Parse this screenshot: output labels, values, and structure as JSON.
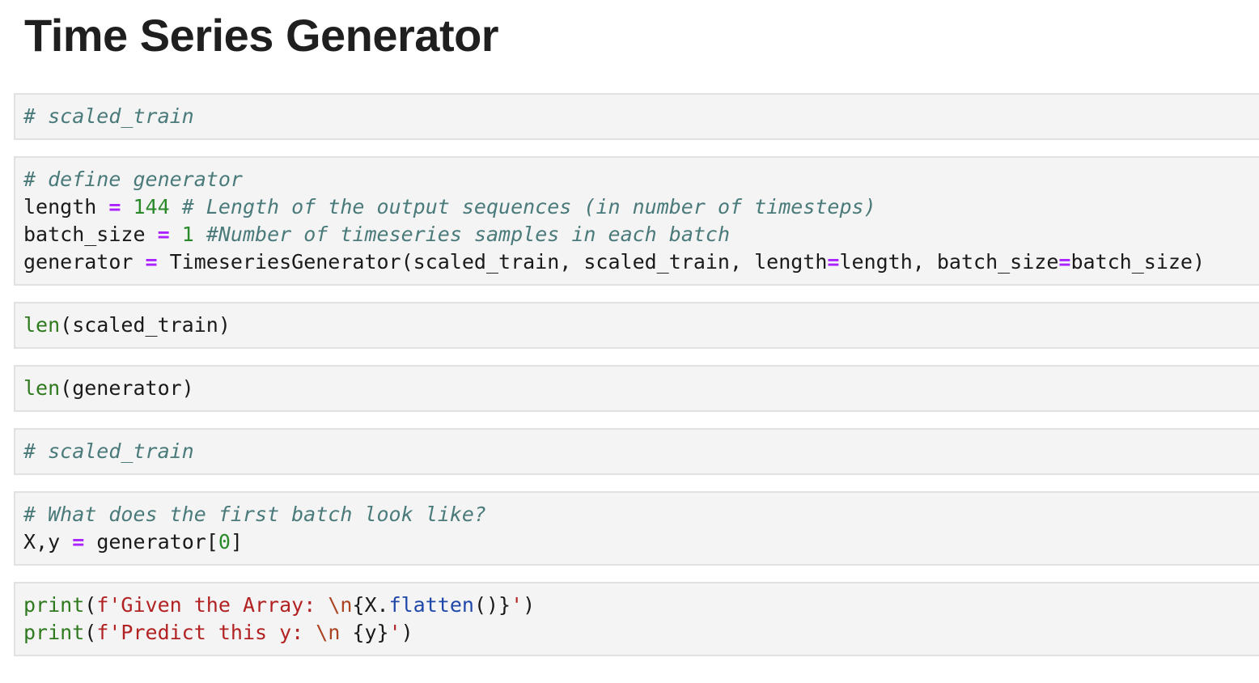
{
  "page": {
    "title": "Time Series Generator"
  },
  "cells": [
    {
      "lines": [
        [
          {
            "t": "# scaled_train",
            "c": "cm"
          }
        ]
      ]
    },
    {
      "lines": [
        [
          {
            "t": "# define generator",
            "c": "cm"
          }
        ],
        [
          {
            "t": "length "
          },
          {
            "t": "=",
            "c": "op"
          },
          {
            "t": " "
          },
          {
            "t": "144",
            "c": "num"
          },
          {
            "t": " "
          },
          {
            "t": "# Length of the output sequences (in number of timesteps)",
            "c": "cm"
          }
        ],
        [
          {
            "t": "batch_size "
          },
          {
            "t": "=",
            "c": "op"
          },
          {
            "t": " "
          },
          {
            "t": "1",
            "c": "num"
          },
          {
            "t": " "
          },
          {
            "t": "#Number of timeseries samples in each batch",
            "c": "cm"
          }
        ],
        [
          {
            "t": "generator "
          },
          {
            "t": "=",
            "c": "op"
          },
          {
            "t": " TimeseriesGenerator(scaled_train, scaled_train, length"
          },
          {
            "t": "=",
            "c": "op"
          },
          {
            "t": "length, batch_size"
          },
          {
            "t": "=",
            "c": "op"
          },
          {
            "t": "batch_size)"
          }
        ]
      ]
    },
    {
      "lines": [
        [
          {
            "t": "len",
            "c": "bi"
          },
          {
            "t": "(scaled_train)"
          }
        ]
      ]
    },
    {
      "lines": [
        [
          {
            "t": "len",
            "c": "bi"
          },
          {
            "t": "(generator)"
          }
        ]
      ]
    },
    {
      "lines": [
        [
          {
            "t": "# scaled_train",
            "c": "cm"
          }
        ]
      ]
    },
    {
      "lines": [
        [
          {
            "t": "# What does the first batch look like?",
            "c": "cm"
          }
        ],
        [
          {
            "t": "X,y "
          },
          {
            "t": "=",
            "c": "op"
          },
          {
            "t": " generator["
          },
          {
            "t": "0",
            "c": "num"
          },
          {
            "t": "]"
          }
        ]
      ]
    },
    {
      "lines": [
        [
          {
            "t": "print",
            "c": "bi"
          },
          {
            "t": "("
          },
          {
            "t": "f'Given the Array: ",
            "c": "str"
          },
          {
            "t": "\\n",
            "c": "esc"
          },
          {
            "t": "{X."
          },
          {
            "t": "flatten",
            "c": "attr"
          },
          {
            "t": "()}"
          },
          {
            "t": "'",
            "c": "str"
          },
          {
            "t": ")"
          }
        ],
        [
          {
            "t": "print",
            "c": "bi"
          },
          {
            "t": "("
          },
          {
            "t": "f'Predict this y: ",
            "c": "str"
          },
          {
            "t": "\\n",
            "c": "esc"
          },
          {
            "t": " {y}"
          },
          {
            "t": "'",
            "c": "str"
          },
          {
            "t": ")"
          }
        ]
      ]
    }
  ]
}
